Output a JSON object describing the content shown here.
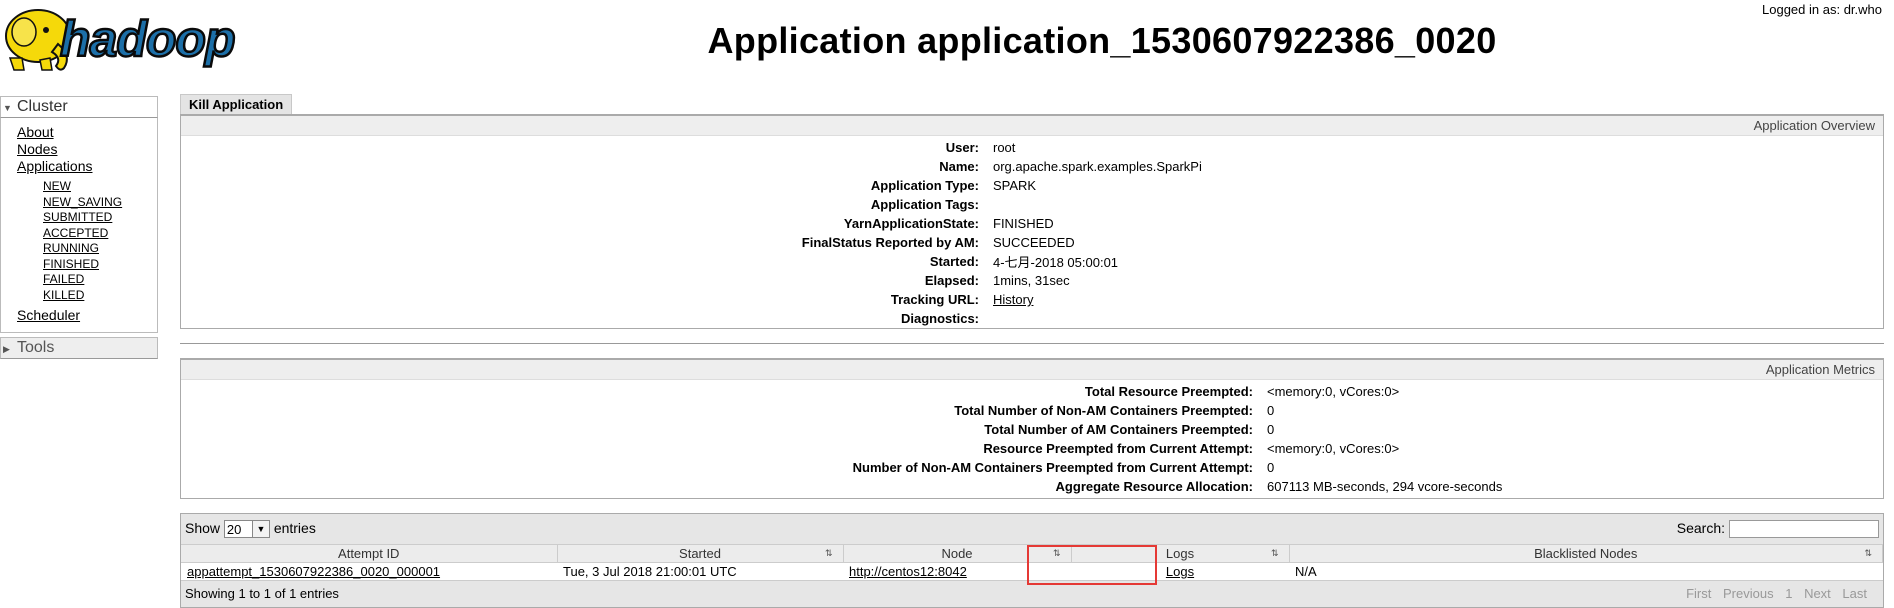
{
  "header": {
    "logo_text": "hadoop",
    "logged_in": "Logged in as: dr.who",
    "title": "Application application_1530607922386_0020"
  },
  "nav": {
    "cluster_label": "Cluster",
    "cluster_links": [
      "About",
      "Nodes",
      "Applications"
    ],
    "app_states": [
      "NEW",
      "NEW_SAVING",
      "SUBMITTED",
      "ACCEPTED",
      "RUNNING",
      "FINISHED",
      "FAILED",
      "KILLED"
    ],
    "scheduler_label": "Scheduler",
    "tools_label": "Tools"
  },
  "kill_button": "Kill Application",
  "overview": {
    "title": "Application Overview",
    "rows": [
      {
        "label": "User:",
        "value": "root"
      },
      {
        "label": "Name:",
        "value": "org.apache.spark.examples.SparkPi"
      },
      {
        "label": "Application Type:",
        "value": "SPARK"
      },
      {
        "label": "Application Tags:",
        "value": ""
      },
      {
        "label": "YarnApplicationState:",
        "value": "FINISHED"
      },
      {
        "label": "FinalStatus Reported by AM:",
        "value": "SUCCEEDED"
      },
      {
        "label": "Started:",
        "value": "4-七月-2018 05:00:01"
      },
      {
        "label": "Elapsed:",
        "value": "1mins, 31sec"
      },
      {
        "label": "Tracking URL:",
        "value": "History"
      },
      {
        "label": "Diagnostics:",
        "value": ""
      }
    ]
  },
  "metrics": {
    "title": "Application Metrics",
    "rows": [
      {
        "label": "Total Resource Preempted:",
        "value": "<memory:0, vCores:0>"
      },
      {
        "label": "Total Number of Non-AM Containers Preempted:",
        "value": "0"
      },
      {
        "label": "Total Number of AM Containers Preempted:",
        "value": "0"
      },
      {
        "label": "Resource Preempted from Current Attempt:",
        "value": "<memory:0, vCores:0>"
      },
      {
        "label": "Number of Non-AM Containers Preempted from Current Attempt:",
        "value": "0"
      },
      {
        "label": "Aggregate Resource Allocation:",
        "value": "607113 MB-seconds, 294 vcore-seconds"
      }
    ]
  },
  "attempts": {
    "show_label": "Show",
    "page_length": "20",
    "entries_label": "entries",
    "search_label": "Search:",
    "search_value": "",
    "columns": [
      "Attempt ID",
      "Started",
      "Node",
      "Logs",
      "Blacklisted Nodes"
    ],
    "rows": [
      {
        "attempt_id": "appattempt_1530607922386_0020_000001",
        "started": "Tue, 3 Jul 2018 21:00:01 UTC",
        "node": "http://centos12:8042",
        "logs": "Logs",
        "blacklisted": "N/A"
      }
    ],
    "info": "Showing 1 to 1 of 1 entries",
    "pager": [
      "First",
      "Previous",
      "1",
      "Next",
      "Last"
    ]
  },
  "colors": {
    "highlight_box": "#e53935",
    "logo_yellow": "#f5d90a",
    "logo_blue": "#1c6fa8"
  }
}
